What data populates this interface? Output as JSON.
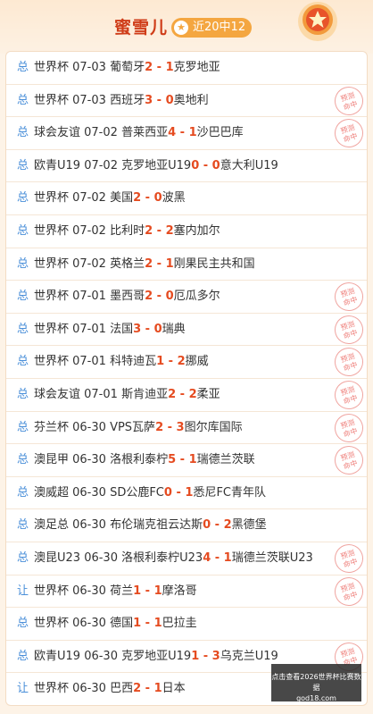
{
  "header": {
    "title": "蜜雪儿",
    "badge_star": "★",
    "badge_text": "近20中12"
  },
  "colors": {
    "score": "#e54b20",
    "type": "#4a8fd9",
    "accent": "#cf3c18"
  },
  "stamp_text": "预测命中",
  "matches": [
    {
      "type": "总",
      "league": "世界杯",
      "date": "07-03",
      "home": "葡萄牙",
      "hs": "2",
      "as": "1",
      "away": "克罗地亚",
      "hit": false
    },
    {
      "type": "总",
      "league": "世界杯",
      "date": "07-03",
      "home": "西班牙",
      "hs": "3",
      "as": "0",
      "away": "奥地利",
      "hit": true
    },
    {
      "type": "总",
      "league": "球会友谊",
      "date": "07-02",
      "home": "普莱西亚",
      "hs": "4",
      "as": "1",
      "away": "沙巴巴库",
      "hit": true
    },
    {
      "type": "总",
      "league": "欧青U19",
      "date": "07-02",
      "home": "克罗地亚U19",
      "hs": "0",
      "as": "0",
      "away": "意大利U19",
      "hit": false
    },
    {
      "type": "总",
      "league": "世界杯",
      "date": "07-02",
      "home": "美国",
      "hs": "2",
      "as": "0",
      "away": "波黑",
      "hit": false
    },
    {
      "type": "总",
      "league": "世界杯",
      "date": "07-02",
      "home": "比利时",
      "hs": "2",
      "as": "2",
      "away": "塞内加尔",
      "hit": false
    },
    {
      "type": "总",
      "league": "世界杯",
      "date": "07-02",
      "home": "英格兰",
      "hs": "2",
      "as": "1",
      "away": "刚果民主共和国",
      "hit": false
    },
    {
      "type": "总",
      "league": "世界杯",
      "date": "07-01",
      "home": "墨西哥",
      "hs": "2",
      "as": "0",
      "away": "厄瓜多尔",
      "hit": true
    },
    {
      "type": "总",
      "league": "世界杯",
      "date": "07-01",
      "home": "法国",
      "hs": "3",
      "as": "0",
      "away": "瑞典",
      "hit": true
    },
    {
      "type": "总",
      "league": "世界杯",
      "date": "07-01",
      "home": "科特迪瓦",
      "hs": "1",
      "as": "2",
      "away": "挪威",
      "hit": true
    },
    {
      "type": "总",
      "league": "球会友谊",
      "date": "07-01",
      "home": "斯肯迪亚",
      "hs": "2",
      "as": "2",
      "away": "柔亚",
      "hit": true
    },
    {
      "type": "总",
      "league": "芬兰杯",
      "date": "06-30",
      "home": "VPS瓦萨",
      "hs": "2",
      "as": "3",
      "away": "图尔库国际",
      "hit": true
    },
    {
      "type": "总",
      "league": "澳昆甲",
      "date": "06-30",
      "home": "洛根利泰柠",
      "hs": "5",
      "as": "1",
      "away": "瑞德兰茨联",
      "hit": true
    },
    {
      "type": "总",
      "league": "澳威超",
      "date": "06-30",
      "home": "SD公鹿FC",
      "hs": "0",
      "as": "1",
      "away": "悉尼FC青年队",
      "hit": false
    },
    {
      "type": "总",
      "league": "澳足总",
      "date": "06-30",
      "home": "布伦瑞克祖云达斯",
      "hs": "0",
      "as": "2",
      "away": "黑德堡",
      "hit": false
    },
    {
      "type": "总",
      "league": "澳昆U23",
      "date": "06-30",
      "home": "洛根利泰柠U23",
      "hs": "4",
      "as": "1",
      "away": "瑞德兰茨联U23",
      "hit": true
    },
    {
      "type": "让",
      "league": "世界杯",
      "date": "06-30",
      "home": "荷兰",
      "hs": "1",
      "as": "1",
      "away": "摩洛哥",
      "hit": true
    },
    {
      "type": "总",
      "league": "世界杯",
      "date": "06-30",
      "home": "德国",
      "hs": "1",
      "as": "1",
      "away": "巴拉圭",
      "hit": false
    },
    {
      "type": "总",
      "league": "欧青U19",
      "date": "06-30",
      "home": "克罗地亚U19",
      "hs": "1",
      "as": "3",
      "away": "乌克兰U19",
      "hit": true
    },
    {
      "type": "让",
      "league": "世界杯",
      "date": "06-30",
      "home": "巴西",
      "hs": "2",
      "as": "1",
      "away": "日本",
      "hit": false
    }
  ],
  "watermark": {
    "line1": "点击查看2026世界杯比赛数据",
    "line2": "god18.com"
  }
}
